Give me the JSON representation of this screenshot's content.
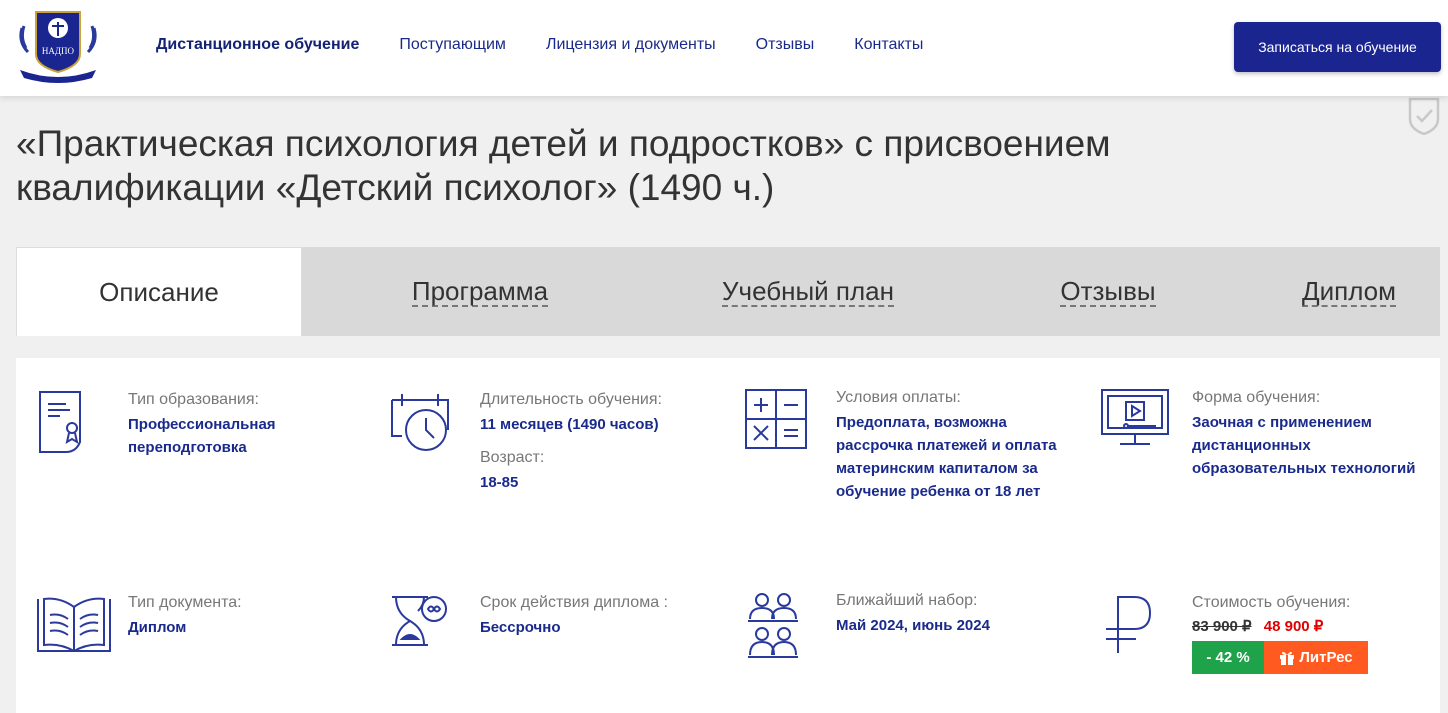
{
  "header": {
    "logo_text": "НАДПО",
    "nav": [
      {
        "label": "Дистанционное обучение",
        "active": true
      },
      {
        "label": "Поступающим",
        "active": false
      },
      {
        "label": "Лицензия и документы",
        "active": false
      },
      {
        "label": "Отзывы",
        "active": false
      },
      {
        "label": "Контакты",
        "active": false
      }
    ],
    "cta_label": "Записаться на обучение"
  },
  "page": {
    "title": "«Практическая психология детей и подростков» с присвоением квалификации «Детский психолог» (1490 ч.)"
  },
  "tabs": [
    {
      "label": "Описание",
      "active": true
    },
    {
      "label": "Программа",
      "active": false
    },
    {
      "label": "Учебный план",
      "active": false
    },
    {
      "label": "Отзывы",
      "active": false
    },
    {
      "label": "Диплом",
      "active": false
    }
  ],
  "info": {
    "edu_type": {
      "icon": "certificate-icon",
      "label": "Тип образования:",
      "value": "Профессиональная переподготовка"
    },
    "duration": {
      "icon": "calendar-clock-icon",
      "label": "Длительность обучения:",
      "value": "11 месяцев (1490 часов)",
      "label2": "Возраст:",
      "value2": "18-85"
    },
    "payment": {
      "icon": "calculator-icon",
      "label": "Условия оплаты:",
      "value": "Предоплата, возможна рассрочка платежей и оплата материнским капиталом за обучение ребенка от 18 лет"
    },
    "form": {
      "icon": "monitor-play-icon",
      "label": "Форма обучения:",
      "value": "Заочная с применением дистанционных образовательных технологий"
    },
    "doc_type": {
      "icon": "open-book-icon",
      "label": "Тип документа:",
      "value": "Диплом"
    },
    "validity": {
      "icon": "hourglass-infinity-icon",
      "label": "Срок действия диплома :",
      "value": "Бессрочно"
    },
    "enrollment": {
      "icon": "group-icon",
      "label": "Ближайший набор:",
      "value": "Май 2024, июнь 2024"
    },
    "cost": {
      "icon": "ruble-icon",
      "label": "Стоимость обучения:",
      "old_price": "83 900 ₽",
      "new_price": "48 900 ₽",
      "discount": "- 42 %",
      "partner": "ЛитРес"
    }
  },
  "colors": {
    "brand": "#1b2590",
    "link": "#1a2a8c",
    "discount": "#1fa34a",
    "partner": "#ff5a1f",
    "price_new": "#e00000"
  }
}
